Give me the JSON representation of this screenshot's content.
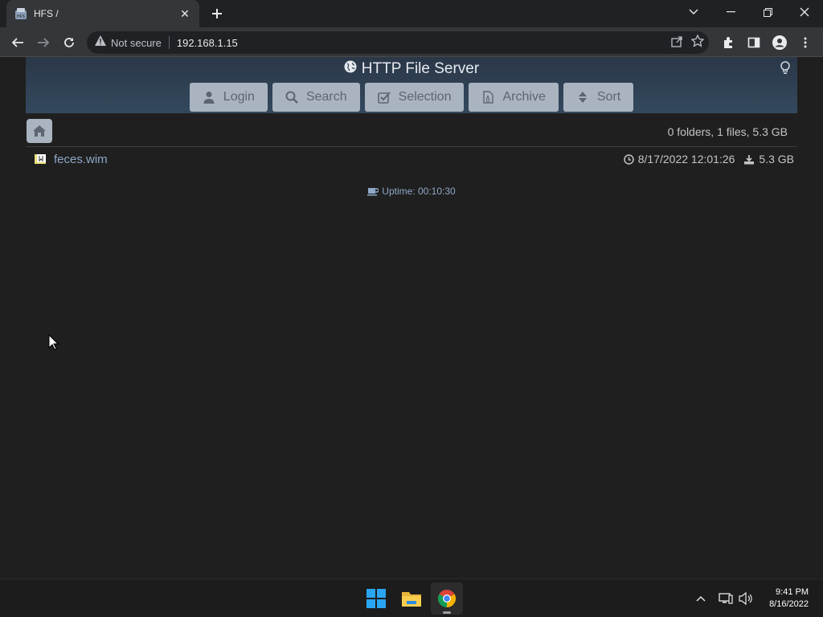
{
  "browser": {
    "tab_title": "HFS /",
    "security_label": "Not secure",
    "url": "192.168.1.15"
  },
  "header": {
    "title": "HTTP File Server",
    "buttons": {
      "login": "Login",
      "search": "Search",
      "selection": "Selection",
      "archive": "Archive",
      "sort": "Sort"
    }
  },
  "listing": {
    "summary": "0 folders, 1 files, 5.3 GB",
    "files": [
      {
        "name": "feces.wim",
        "modified": "8/17/2022 12:01:26",
        "size": "5.3 GB"
      }
    ]
  },
  "footer": {
    "uptime": "Uptime: 00:10:30"
  },
  "taskbar": {
    "time": "9:41 PM",
    "date": "8/16/2022"
  },
  "colors": {
    "header_bg": "#34495e",
    "button_bg": "#a9b4c0",
    "link": "#8fa8c8"
  }
}
